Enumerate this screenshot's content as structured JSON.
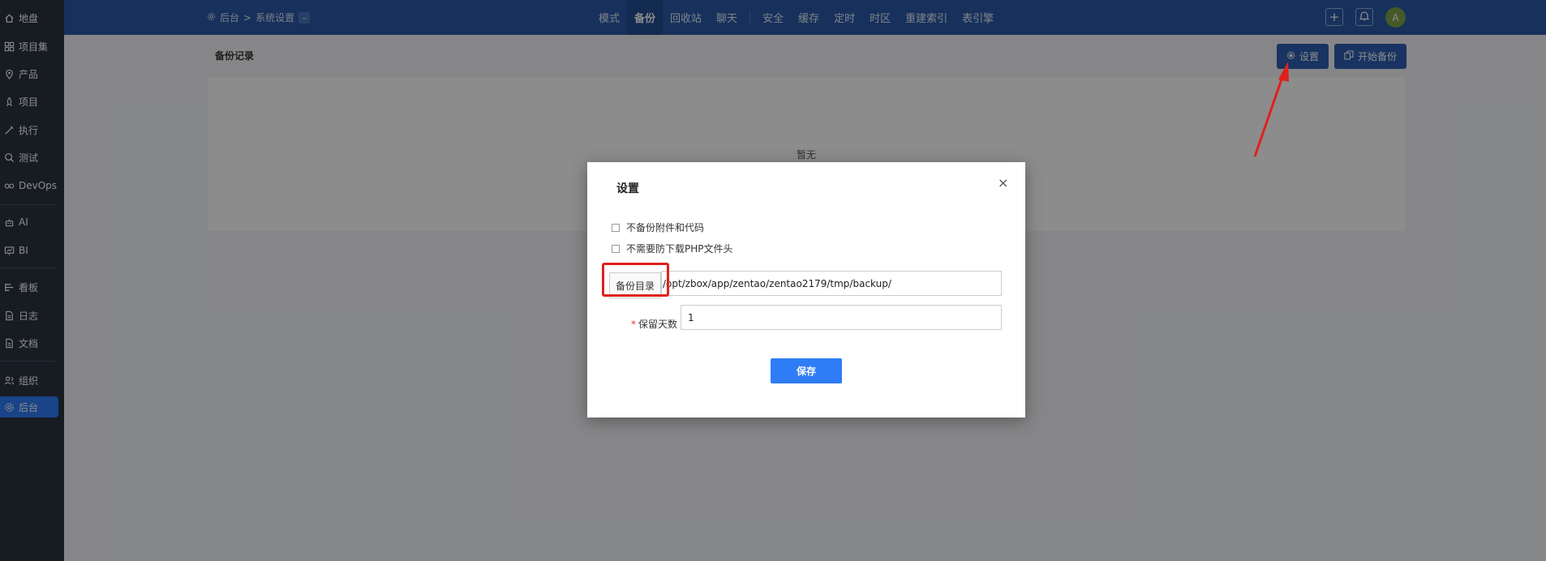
{
  "sidebar": {
    "items": [
      {
        "label": "地盘",
        "icon": "home-icon"
      },
      {
        "label": "项目集",
        "icon": "grid-icon"
      },
      {
        "label": "产品",
        "icon": "pin-icon"
      },
      {
        "label": "项目",
        "icon": "rocket-icon"
      },
      {
        "label": "执行",
        "icon": "wand-icon"
      },
      {
        "label": "测试",
        "icon": "search-icon"
      },
      {
        "label": "DevOps",
        "icon": "infinity-icon"
      },
      {
        "label": "AI",
        "icon": "robot-icon"
      },
      {
        "label": "BI",
        "icon": "chart-icon"
      },
      {
        "label": "看板",
        "icon": "kanban-icon"
      },
      {
        "label": "日志",
        "icon": "doc-icon"
      },
      {
        "label": "文档",
        "icon": "doc-icon"
      },
      {
        "label": "组织",
        "icon": "users-icon"
      },
      {
        "label": "后台",
        "icon": "gear-icon"
      }
    ],
    "active": "后台"
  },
  "header": {
    "breadcrumb_root": "后台",
    "breadcrumb_sep": ">",
    "breadcrumb_current": "系统设置",
    "nav_group1": [
      "模式",
      "备份",
      "回收站",
      "聊天"
    ],
    "nav_group2": [
      "安全",
      "缓存",
      "定时",
      "时区",
      "重建索引",
      "表引擎"
    ],
    "active_nav": "备份",
    "avatar_letter": "A",
    "add_symbol": "+"
  },
  "main": {
    "title": "备份记录",
    "settings_label": "设置",
    "start_backup_label": "开始备份",
    "empty_text": "暂无"
  },
  "modal": {
    "title": "设置",
    "close_symbol": "×",
    "option1": "不备份附件和代码",
    "option2": "不需要防下载PHP文件头",
    "dir_label": "备份目录",
    "dir_value": "/opt/zbox/app/zentao/zentao2179/tmp/backup/",
    "keep_required": "*",
    "keep_label": "保留天数",
    "keep_value": "1",
    "save_label": "保存"
  },
  "colors": {
    "sidebar_bg": "#2b3340",
    "topbar_bg": "#2a5aa8",
    "primary": "#2e7df6",
    "annotation": "#e0211b"
  }
}
